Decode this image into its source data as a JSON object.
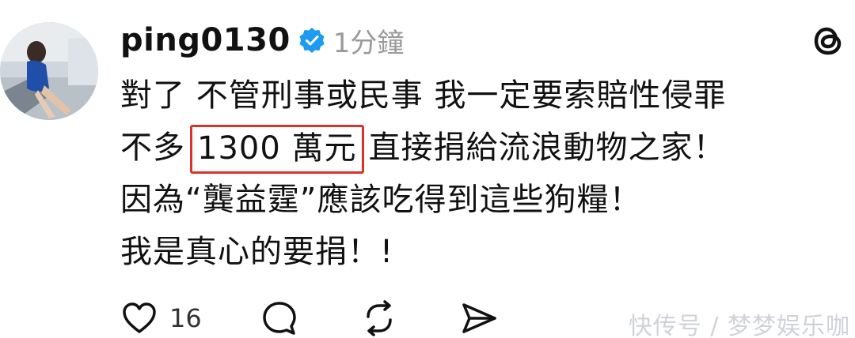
{
  "post": {
    "username": "ping0130",
    "timestamp": "1分鐘",
    "lines": {
      "line1": "對了 不管刑事或民事 我一定要索賠性侵罪",
      "line2_before": "不多",
      "line2_highlight": "1300 萬元",
      "line2_after": "直接捐給流浪動物之家！",
      "line3": "因為“龔益霆”應該吃得到這些狗糧！",
      "line4": "我是真心的要捐！!"
    },
    "like_count": "16"
  },
  "icons": {
    "verified": "verified-badge-icon",
    "threads": "threads-logo-icon",
    "like": "heart-icon",
    "comment": "comment-icon",
    "repost": "repost-icon",
    "share": "send-icon"
  },
  "colors": {
    "verified_blue": "#1d9bf0",
    "highlight_border": "#d9332b",
    "timestamp_gray": "#9a9a9a"
  },
  "watermark": "快传号 / 梦梦娱乐咖"
}
